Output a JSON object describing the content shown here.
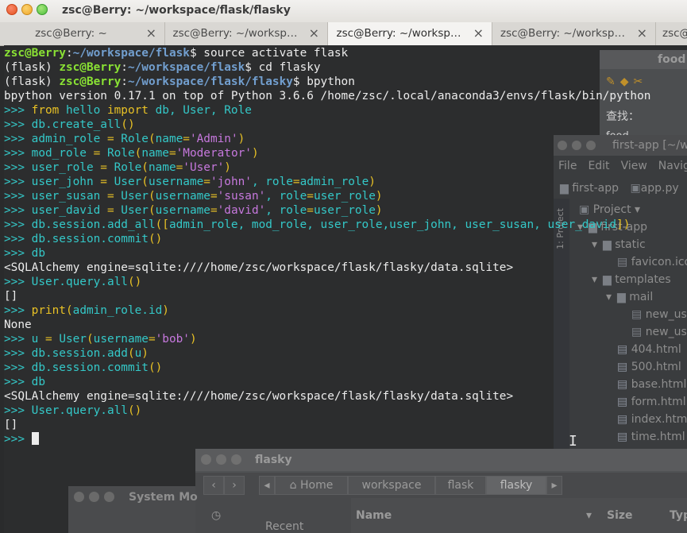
{
  "window": {
    "title": "zsc@Berry: ~/workspace/flask/flasky"
  },
  "tabs": [
    {
      "label": "zsc@Berry: ~",
      "active": false
    },
    {
      "label": "zsc@Berry: ~/worksp…",
      "active": false
    },
    {
      "label": "zsc@Berry: ~/worksp…",
      "active": true
    },
    {
      "label": "zsc@Berry: ~/worksp…",
      "active": false
    },
    {
      "label": "zsc@Berry: ~",
      "active": false
    }
  ],
  "tab_close_glyph": "×",
  "terminal": {
    "colors": {
      "background": "#2c2d2e",
      "user": "#8ae234",
      "path": "#729fcf",
      "prompt": "#34c8c8",
      "keyword": "#e8c125",
      "string": "#c678dd"
    },
    "lines": [
      [
        [
          "usr",
          "zsc@Berry"
        ],
        [
          "txt",
          ":"
        ],
        [
          "path",
          "~/workspace/flask"
        ],
        [
          "txt",
          "$ source activate flask"
        ]
      ],
      [
        [
          "txt",
          "(flask) "
        ],
        [
          "usr",
          "zsc@Berry"
        ],
        [
          "txt",
          ":"
        ],
        [
          "path",
          "~/workspace/flask"
        ],
        [
          "txt",
          "$ cd flasky"
        ]
      ],
      [
        [
          "txt",
          "(flask) "
        ],
        [
          "usr",
          "zsc@Berry"
        ],
        [
          "txt",
          ":"
        ],
        [
          "path",
          "~/workspace/flask/flasky"
        ],
        [
          "txt",
          "$ bpython"
        ]
      ],
      [
        [
          "txt",
          "bpython version 0.17.1 on top of Python 3.6.6 /home/zsc/.local/anaconda3/envs/flask/bin/python"
        ]
      ],
      [
        [
          "prompt",
          ">>> "
        ],
        [
          "kw",
          "from"
        ],
        [
          "fn",
          " hello "
        ],
        [
          "kw",
          "import"
        ],
        [
          "fn",
          " db, User, Role"
        ]
      ],
      [
        [
          "prompt",
          ">>> "
        ],
        [
          "fn",
          "db.create_all"
        ],
        [
          "op",
          "()"
        ]
      ],
      [
        [
          "prompt",
          ">>> "
        ],
        [
          "fn",
          "admin_role "
        ],
        [
          "op",
          "="
        ],
        [
          "fn",
          " Role"
        ],
        [
          "op",
          "("
        ],
        [
          "fn",
          "name"
        ],
        [
          "op",
          "="
        ],
        [
          "str",
          "'Admin'"
        ],
        [
          "op",
          ")"
        ]
      ],
      [
        [
          "prompt",
          ">>> "
        ],
        [
          "fn",
          "mod_role "
        ],
        [
          "op",
          "="
        ],
        [
          "fn",
          " Role"
        ],
        [
          "op",
          "("
        ],
        [
          "fn",
          "name"
        ],
        [
          "op",
          "="
        ],
        [
          "str",
          "'Moderator'"
        ],
        [
          "op",
          ")"
        ]
      ],
      [
        [
          "prompt",
          ">>> "
        ],
        [
          "fn",
          "user_role "
        ],
        [
          "op",
          "="
        ],
        [
          "fn",
          " Role"
        ],
        [
          "op",
          "("
        ],
        [
          "fn",
          "name"
        ],
        [
          "op",
          "="
        ],
        [
          "str",
          "'User'"
        ],
        [
          "op",
          ")"
        ]
      ],
      [
        [
          "prompt",
          ">>> "
        ],
        [
          "fn",
          "user_john "
        ],
        [
          "op",
          "="
        ],
        [
          "fn",
          " User"
        ],
        [
          "op",
          "("
        ],
        [
          "fn",
          "username"
        ],
        [
          "op",
          "="
        ],
        [
          "str",
          "'john'"
        ],
        [
          "fn",
          ", role"
        ],
        [
          "op",
          "="
        ],
        [
          "fn",
          "admin_role"
        ],
        [
          "op",
          ")"
        ]
      ],
      [
        [
          "prompt",
          ">>> "
        ],
        [
          "fn",
          "user_susan "
        ],
        [
          "op",
          "="
        ],
        [
          "fn",
          " User"
        ],
        [
          "op",
          "("
        ],
        [
          "fn",
          "username"
        ],
        [
          "op",
          "="
        ],
        [
          "str",
          "'susan'"
        ],
        [
          "fn",
          ", role"
        ],
        [
          "op",
          "="
        ],
        [
          "fn",
          "user_role"
        ],
        [
          "op",
          ")"
        ]
      ],
      [
        [
          "prompt",
          ">>> "
        ],
        [
          "fn",
          "user_david "
        ],
        [
          "op",
          "="
        ],
        [
          "fn",
          " User"
        ],
        [
          "op",
          "("
        ],
        [
          "fn",
          "username"
        ],
        [
          "op",
          "="
        ],
        [
          "str",
          "'david'"
        ],
        [
          "fn",
          ", role"
        ],
        [
          "op",
          "="
        ],
        [
          "fn",
          "user_role"
        ],
        [
          "op",
          ")"
        ]
      ],
      [
        [
          "prompt",
          ">>> "
        ],
        [
          "fn",
          "db.session.add_all"
        ],
        [
          "op",
          "(["
        ],
        [
          "fn",
          "admin_role, mod_role, user_role,user_john, user_susan, user_david"
        ],
        [
          "op",
          "])"
        ]
      ],
      [
        [
          "prompt",
          ">>> "
        ],
        [
          "fn",
          "db.session.commit"
        ],
        [
          "op",
          "()"
        ]
      ],
      [
        [
          "prompt",
          ">>> "
        ],
        [
          "fn",
          "db"
        ]
      ],
      [
        [
          "txt",
          "<SQLAlchemy engine=sqlite:////home/zsc/workspace/flask/flasky/data.sqlite>"
        ]
      ],
      [
        [
          "prompt",
          ">>> "
        ],
        [
          "fn",
          "User.query.all"
        ],
        [
          "op",
          "()"
        ]
      ],
      [
        [
          "txt",
          "[]"
        ]
      ],
      [
        [
          "prompt",
          ">>> "
        ],
        [
          "kw",
          "print"
        ],
        [
          "op",
          "("
        ],
        [
          "fn",
          "admin_role.id"
        ],
        [
          "op",
          ")"
        ]
      ],
      [
        [
          "txt",
          "None"
        ]
      ],
      [
        [
          "prompt",
          ">>> "
        ],
        [
          "fn",
          "u "
        ],
        [
          "op",
          "="
        ],
        [
          "fn",
          " User"
        ],
        [
          "op",
          "("
        ],
        [
          "fn",
          "username"
        ],
        [
          "op",
          "="
        ],
        [
          "str",
          "'bob'"
        ],
        [
          "op",
          ")"
        ]
      ],
      [
        [
          "prompt",
          ">>> "
        ],
        [
          "fn",
          "db.session.add"
        ],
        [
          "op",
          "("
        ],
        [
          "fn",
          "u"
        ],
        [
          "op",
          ")"
        ]
      ],
      [
        [
          "prompt",
          ">>> "
        ],
        [
          "fn",
          "db.session.commit"
        ],
        [
          "op",
          "()"
        ]
      ],
      [
        [
          "prompt",
          ">>> "
        ],
        [
          "fn",
          "db"
        ]
      ],
      [
        [
          "txt",
          "<SQLAlchemy engine=sqlite:////home/zsc/workspace/flask/flasky/data.sqlite>"
        ]
      ],
      [
        [
          "prompt",
          ">>> "
        ],
        [
          "fn",
          "User.query.all"
        ],
        [
          "op",
          "()"
        ]
      ],
      [
        [
          "txt",
          "[]"
        ]
      ],
      [
        [
          "prompt",
          ">>> "
        ]
      ]
    ]
  },
  "background_windows": {
    "food": {
      "title": "food",
      "find_label": "查找：",
      "find_text": "food"
    },
    "ide": {
      "title": "first-app [~/w",
      "menu": [
        "File",
        "Edit",
        "View",
        "Navig"
      ],
      "breadcrumb": [
        "first-app",
        "app.py"
      ],
      "project_label": "Project",
      "side_label": "1: Project",
      "tree": [
        {
          "label": "first-app",
          "kind": "folder",
          "depth": 0,
          "arrow": "▾"
        },
        {
          "label": "static",
          "kind": "folder",
          "depth": 1,
          "arrow": "▾"
        },
        {
          "label": "favicon.ico",
          "kind": "file",
          "depth": 2,
          "arrow": ""
        },
        {
          "label": "templates",
          "kind": "folder",
          "depth": 1,
          "arrow": "▾"
        },
        {
          "label": "mail",
          "kind": "folder",
          "depth": 2,
          "arrow": "▾"
        },
        {
          "label": "new_us",
          "kind": "file",
          "depth": 3,
          "arrow": ""
        },
        {
          "label": "new_us",
          "kind": "file",
          "depth": 3,
          "arrow": ""
        },
        {
          "label": "404.html",
          "kind": "html",
          "depth": 2,
          "arrow": ""
        },
        {
          "label": "500.html",
          "kind": "html",
          "depth": 2,
          "arrow": ""
        },
        {
          "label": "base.html",
          "kind": "html",
          "depth": 2,
          "arrow": ""
        },
        {
          "label": "form.html",
          "kind": "html",
          "depth": 2,
          "arrow": ""
        },
        {
          "label": "index.html",
          "kind": "html",
          "depth": 2,
          "arrow": ""
        },
        {
          "label": "time.html",
          "kind": "html",
          "depth": 2,
          "arrow": ""
        }
      ]
    },
    "files": {
      "title": "flasky",
      "path": [
        "Home",
        "workspace",
        "flask",
        "flasky"
      ],
      "sidebar_item": "Recent",
      "columns": [
        "Name",
        "Size",
        "Typ"
      ]
    },
    "sysmon": {
      "title": "System Mo"
    }
  }
}
